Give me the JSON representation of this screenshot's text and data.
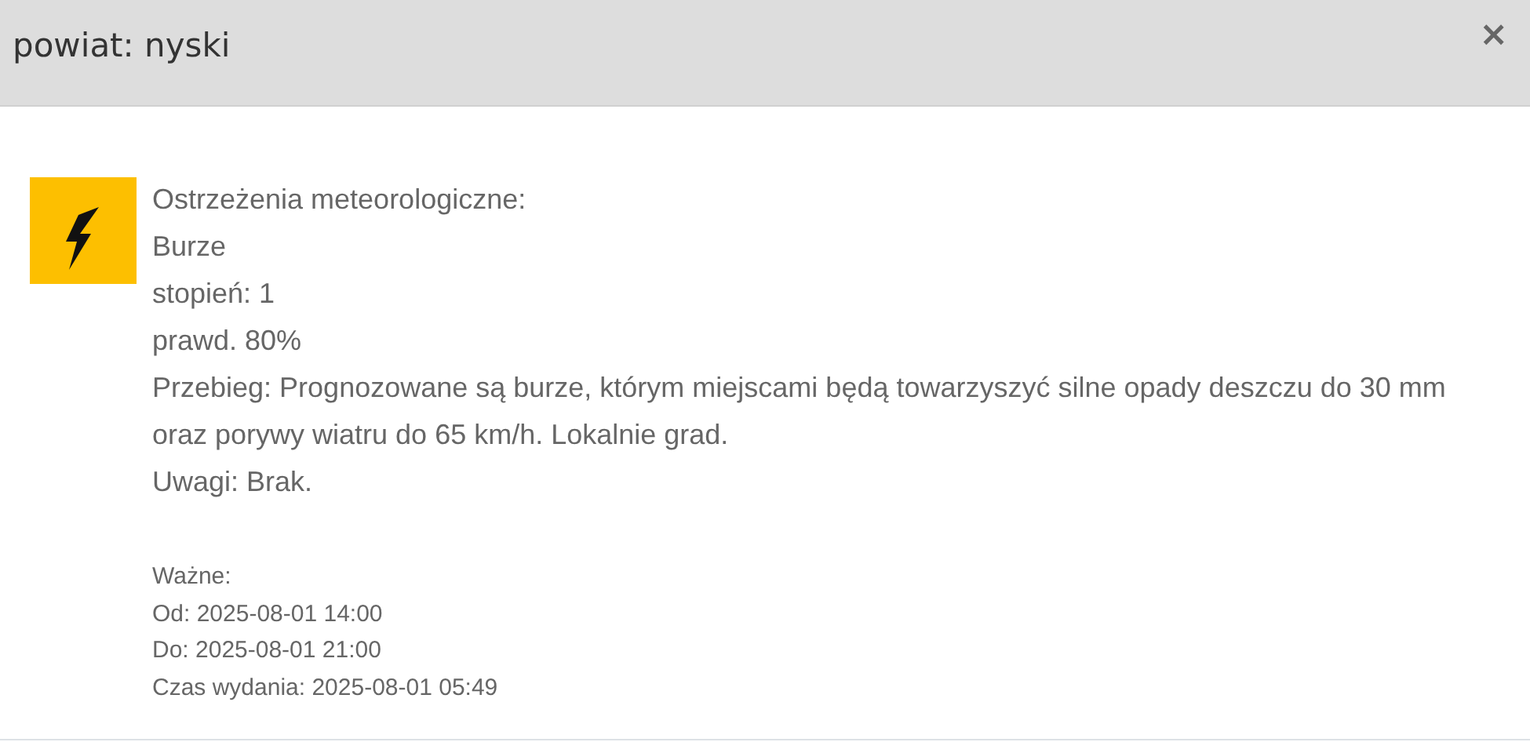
{
  "dialog": {
    "title": "powiat: nyski",
    "close": "×"
  },
  "warning": {
    "heading": "Ostrzeżenia meteorologiczne:",
    "type": "Burze",
    "degree": "stopień: 1",
    "probability": "prawd. 80%",
    "course": "Przebieg: Prognozowane są burze, którym miejscami będą towarzyszyć silne opady deszczu do 30 mm oraz porywy wiatru do 65 km/h. Lokalnie grad.",
    "remarks": "Uwagi: Brak."
  },
  "validity": {
    "label": "Ważne:",
    "from": "Od: 2025-08-01 14:00",
    "to": "Do: 2025-08-01 21:00",
    "issued": "Czas wydania: 2025-08-01 05:49"
  }
}
